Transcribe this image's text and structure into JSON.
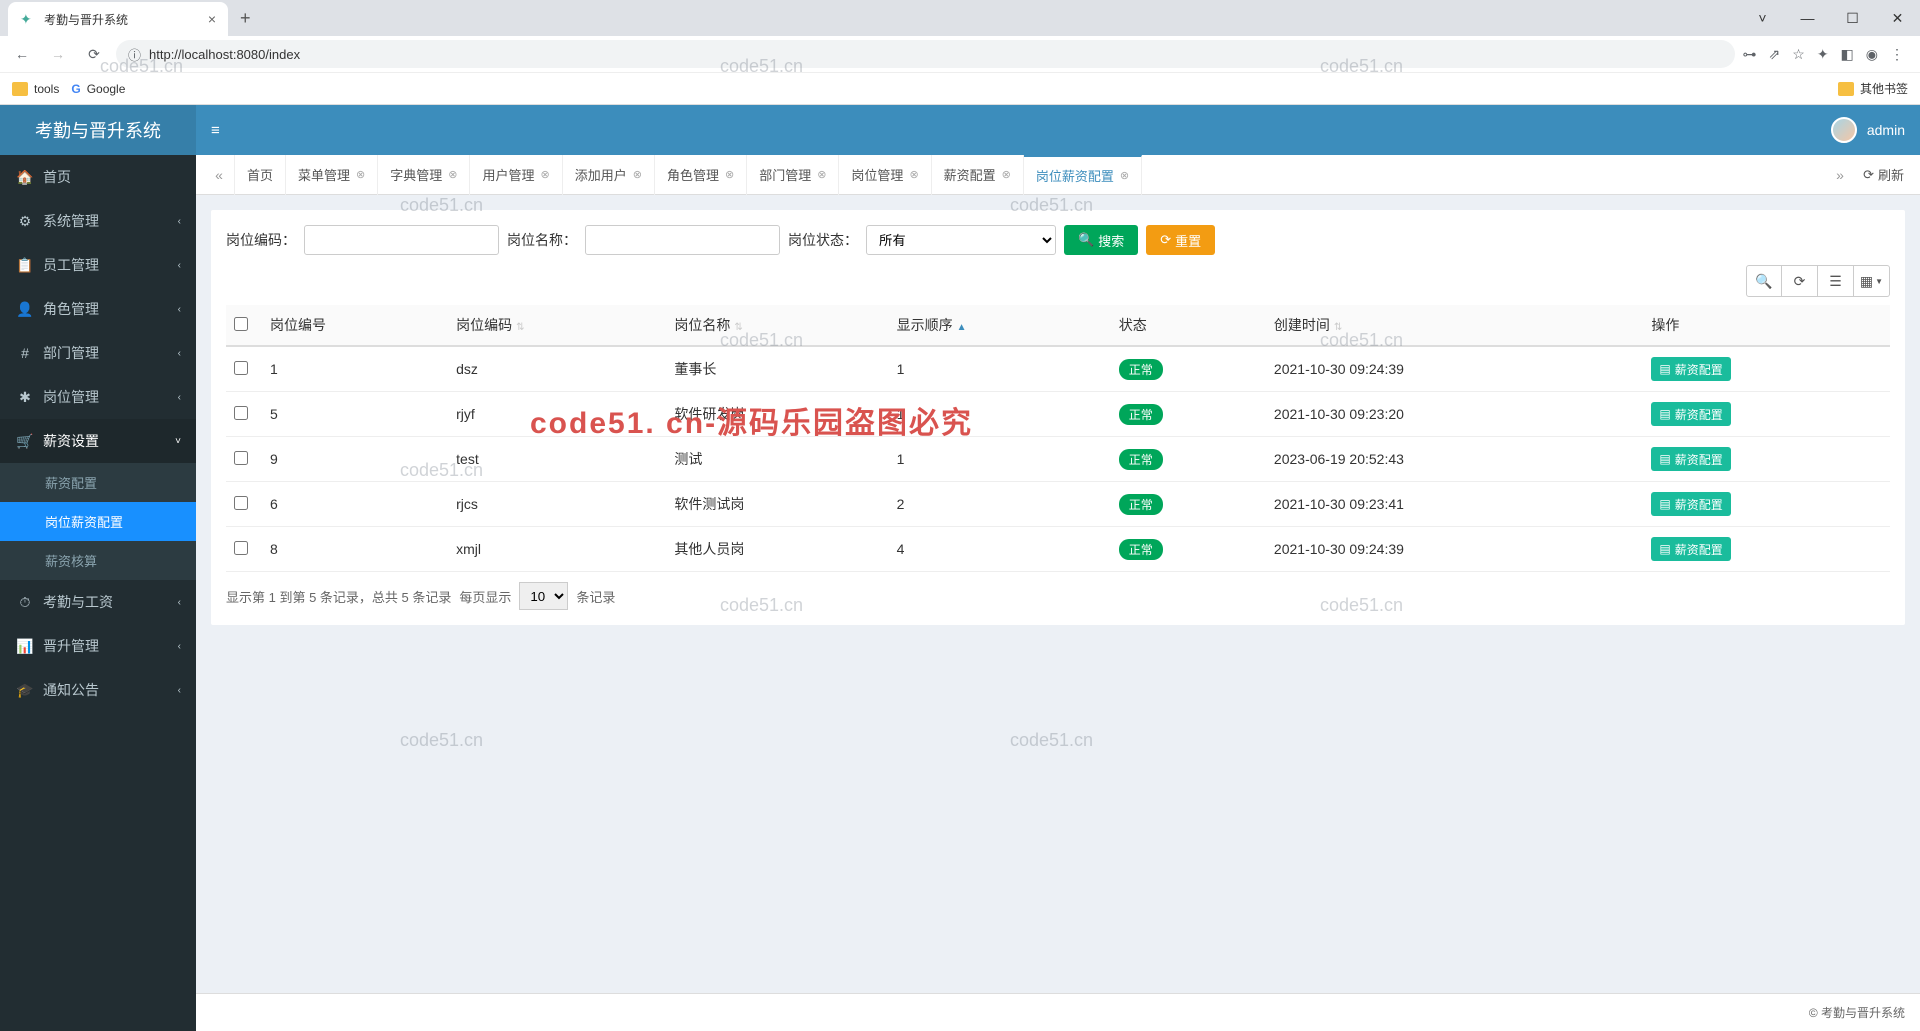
{
  "browser": {
    "tab_title": "考勤与晋升系统",
    "url": "http://localhost:8080/index",
    "bookmarks": {
      "tools": "tools",
      "google": "Google",
      "other": "其他书签"
    }
  },
  "app": {
    "logo": "考勤与晋升系统",
    "user": "admin",
    "footer": "© 考勤与晋升系统"
  },
  "sidebar": {
    "items": [
      {
        "label": "首页"
      },
      {
        "label": "系统管理"
      },
      {
        "label": "员工管理"
      },
      {
        "label": "角色管理"
      },
      {
        "label": "部门管理"
      },
      {
        "label": "岗位管理"
      },
      {
        "label": "薪资设置",
        "open": true,
        "children": [
          {
            "label": "薪资配置"
          },
          {
            "label": "岗位薪资配置",
            "active": true
          },
          {
            "label": "薪资核算"
          }
        ]
      },
      {
        "label": "考勤与工资"
      },
      {
        "label": "晋升管理"
      },
      {
        "label": "通知公告"
      }
    ]
  },
  "tabs": {
    "items": [
      "首页",
      "菜单管理",
      "字典管理",
      "用户管理",
      "添加用户",
      "角色管理",
      "部门管理",
      "岗位管理",
      "薪资配置"
    ],
    "active": "岗位薪资配置",
    "refresh": "刷新"
  },
  "search": {
    "code_label": "岗位编码：",
    "name_label": "岗位名称：",
    "status_label": "岗位状态：",
    "status_value": "所有",
    "search_btn": "搜索",
    "reset_btn": "重置"
  },
  "table": {
    "headers": {
      "id": "岗位编号",
      "code": "岗位编码",
      "name": "岗位名称",
      "order": "显示顺序",
      "status": "状态",
      "created": "创建时间",
      "ops": "操作"
    },
    "status_badge": "正常",
    "action_btn": "薪资配置",
    "rows": [
      {
        "id": "1",
        "code": "dsz",
        "name": "董事长",
        "order": "1",
        "created": "2021-10-30 09:24:39"
      },
      {
        "id": "5",
        "code": "rjyf",
        "name": "软件研发岗",
        "order": "1",
        "created": "2021-10-30 09:23:20"
      },
      {
        "id": "9",
        "code": "test",
        "name": "测试",
        "order": "1",
        "created": "2023-06-19 20:52:43"
      },
      {
        "id": "6",
        "code": "rjcs",
        "name": "软件测试岗",
        "order": "2",
        "created": "2021-10-30 09:23:41"
      },
      {
        "id": "8",
        "code": "xmjl",
        "name": "其他人员岗",
        "order": "4",
        "created": "2021-10-30 09:24:39"
      }
    ]
  },
  "pagination": {
    "info_prefix": "显示第 1 到第 5 条记录，总共 5 条记录",
    "per_page_prefix": "每页显示",
    "page_size": "10",
    "per_page_suffix": "条记录"
  },
  "watermarks": {
    "text": "code51.cn",
    "red": "code51. cn-源码乐园盗图必究"
  }
}
